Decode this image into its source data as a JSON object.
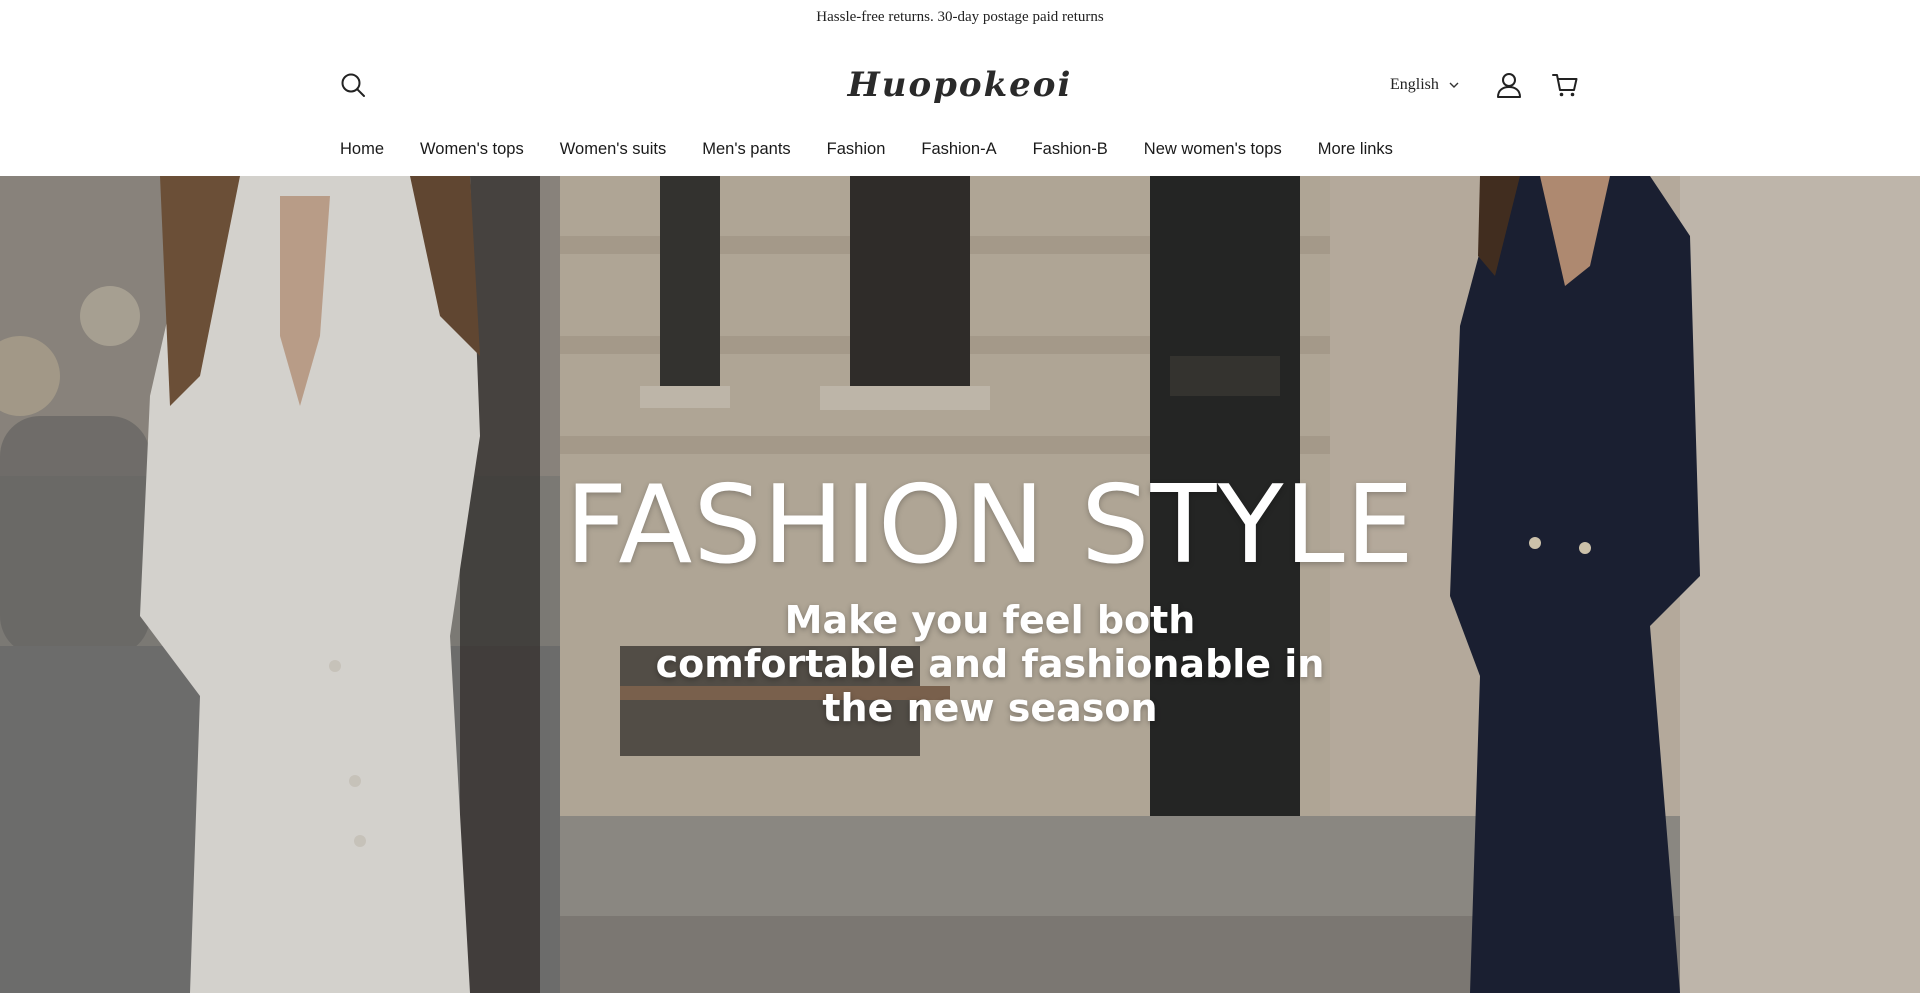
{
  "announcement": {
    "text": "Hassle-free returns. 30-day postage paid returns"
  },
  "header": {
    "logo_text": "Huopokeoi",
    "language": {
      "selected": "English"
    },
    "icons": {
      "search": "search-icon",
      "account": "user-icon",
      "cart": "cart-icon",
      "dropdown": "chevron-down-icon"
    }
  },
  "nav": {
    "items": [
      {
        "label": "Home"
      },
      {
        "label": "Women's tops"
      },
      {
        "label": "Women's suits"
      },
      {
        "label": "Men's pants"
      },
      {
        "label": "Fashion"
      },
      {
        "label": "Fashion-A"
      },
      {
        "label": "Fashion-B"
      },
      {
        "label": "New women's tops"
      },
      {
        "label": "More links"
      }
    ]
  },
  "hero": {
    "title": "FASHION STYLE",
    "subtitle": "Make you feel both comfortable and fashionable in the new season"
  },
  "colors": {
    "text": "#222222",
    "background": "#ffffff",
    "hero_text": "#ffffff",
    "suit_navy": "#1e2438",
    "dress_white": "#f1eee9"
  }
}
